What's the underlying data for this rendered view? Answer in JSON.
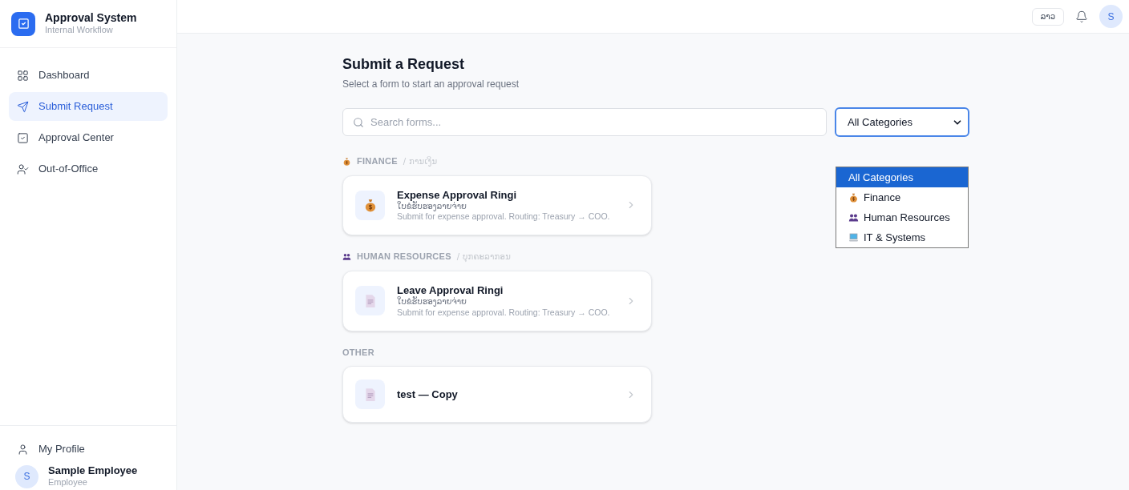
{
  "brand": {
    "title": "Approval System",
    "subtitle": "Internal Workflow"
  },
  "nav": [
    {
      "label": "Dashboard",
      "kind": "grid",
      "selected": false
    },
    {
      "label": "Submit Request",
      "kind": "send",
      "selected": true
    },
    {
      "label": "Approval Center",
      "kind": "check",
      "selected": false
    },
    {
      "label": "Out-of-Office",
      "kind": "away",
      "selected": false
    }
  ],
  "profile_link": "My Profile",
  "user": {
    "initial": "S",
    "name": "Sample Employee",
    "role": "Employee"
  },
  "topbar": {
    "language": "ລາວ",
    "avatar": "S"
  },
  "page": {
    "title": "Submit a Request",
    "subtitle": "Select a form to start an approval request"
  },
  "search": {
    "placeholder": "Search forms..."
  },
  "category_select": {
    "value": "All Categories",
    "options": [
      {
        "label": "All Categories",
        "kind": "all",
        "selected": true
      },
      {
        "label": "Finance",
        "kind": "money",
        "selected": false
      },
      {
        "label": "Human Resources",
        "kind": "people",
        "selected": false
      },
      {
        "label": "IT & Systems",
        "kind": "computer",
        "selected": false
      }
    ]
  },
  "groups": [
    {
      "title": "FINANCE",
      "subtitle": "/ ການເງິນ",
      "kind": "money",
      "forms": [
        {
          "title": "Expense Approval Ringi",
          "subtitle": "ໃບຂໍຮັບຮອງລາຍຈ່າຍ",
          "description": "Submit for expense approval. Routing: Treasury → COO.",
          "kind": "money"
        }
      ]
    },
    {
      "title": "HUMAN RESOURCES",
      "subtitle": "/ ບຸກຄະລາກອນ",
      "kind": "people",
      "forms": [
        {
          "title": "Leave Approval Ringi",
          "subtitle": "ໃບຂໍຮັບຮອງລາຍຈ່າຍ",
          "description": "Submit for expense approval. Routing: Treasury → COO.",
          "kind": "document"
        }
      ]
    },
    {
      "title": "OTHER",
      "kind": "other",
      "forms": [
        {
          "title": "test — Copy",
          "kind": "document"
        }
      ]
    }
  ]
}
